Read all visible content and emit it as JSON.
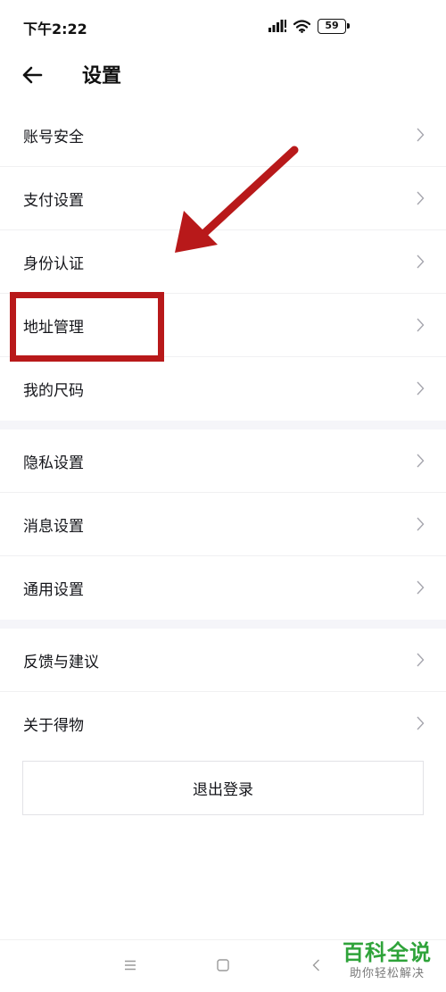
{
  "status_bar": {
    "time": "下午2:22",
    "battery": "59"
  },
  "header": {
    "title": "设置"
  },
  "groups": [
    {
      "items": [
        "账号安全",
        "支付设置",
        "身份认证",
        "地址管理",
        "我的尺码"
      ]
    },
    {
      "items": [
        "隐私设置",
        "消息设置",
        "通用设置"
      ]
    },
    {
      "items": [
        "反馈与建议",
        "关于得物"
      ]
    }
  ],
  "logout_label": "退出登录",
  "watermark": {
    "title": "百科全说",
    "subtitle": "助你轻松解决"
  },
  "colors": {
    "annotation": "#b8191a",
    "watermark": "#2fa33a",
    "text": "#14151a",
    "divider": "#f5f5f9"
  }
}
